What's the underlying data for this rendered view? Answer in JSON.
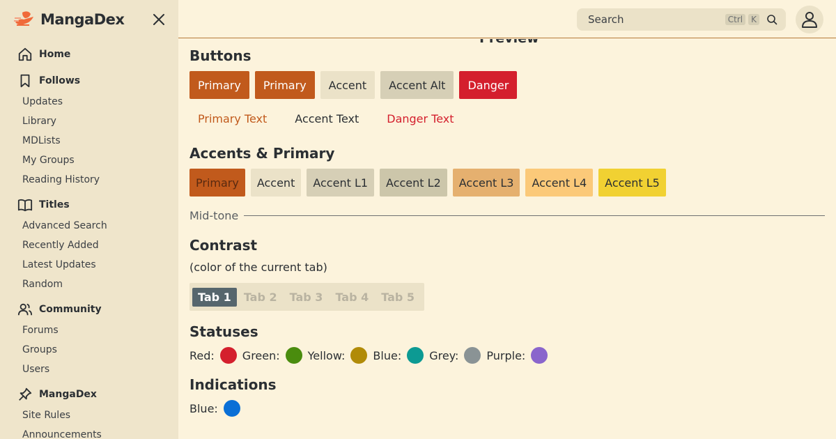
{
  "app": {
    "name": "MangaDex"
  },
  "sidebar": {
    "sections": [
      {
        "label": "Home",
        "icon": "home-icon",
        "items": []
      },
      {
        "label": "Follows",
        "icon": "bookmark-icon",
        "items": [
          "Updates",
          "Library",
          "MDLists",
          "My Groups",
          "Reading History"
        ]
      },
      {
        "label": "Titles",
        "icon": "book-open-icon",
        "items": [
          "Advanced Search",
          "Recently Added",
          "Latest Updates",
          "Random"
        ]
      },
      {
        "label": "Community",
        "icon": "users-icon",
        "items": [
          "Forums",
          "Groups",
          "Users"
        ]
      },
      {
        "label": "MangaDex",
        "icon": "pin-icon",
        "items": [
          "Site Rules",
          "Announcements"
        ]
      }
    ]
  },
  "header": {
    "search_placeholder": "Search",
    "kbd_ctrl": "Ctrl",
    "kbd_k": "K"
  },
  "main": {
    "clipped_title": "Preview",
    "buttons_heading": "Buttons",
    "buttons": [
      {
        "label": "Primary",
        "bg": "#c15a1c",
        "fg": "#ffffff"
      },
      {
        "label": "Primary",
        "bg": "#c15a1c",
        "fg": "#ffffff"
      },
      {
        "label": "Accent",
        "bg": "#ebe2c8",
        "fg": "#2b2f33"
      },
      {
        "label": "Accent Alt",
        "bg": "#d6cfb6",
        "fg": "#2b2f33"
      },
      {
        "label": "Danger",
        "bg": "#d41f2d",
        "fg": "#ffffff"
      }
    ],
    "text_buttons": [
      {
        "label": "Primary Text",
        "fg": "#c15a1c"
      },
      {
        "label": "Accent Text",
        "fg": "#2b2f33"
      },
      {
        "label": "Danger Text",
        "fg": "#d41f2d"
      }
    ],
    "accents_heading": "Accents & Primary",
    "swatches": [
      {
        "label": "Primary",
        "bg": "#c15a1c"
      },
      {
        "label": "Accent",
        "bg": "#ebe2c8"
      },
      {
        "label": "Accent L1",
        "bg": "#d6cfb6"
      },
      {
        "label": "Accent L2",
        "bg": "#ccc6aa"
      },
      {
        "label": "Accent L3",
        "bg": "#e5b06f"
      },
      {
        "label": "Accent L4",
        "bg": "#fbc979"
      },
      {
        "label": "Accent L5",
        "bg": "#f1d132"
      }
    ],
    "midtone_label": "Mid-tone",
    "contrast_heading": "Contrast",
    "contrast_sub": "(color of the current tab)",
    "tabs": [
      "Tab 1",
      "Tab 2",
      "Tab 3",
      "Tab 4",
      "Tab 5"
    ],
    "statuses_heading": "Statuses",
    "statuses": [
      {
        "label": "Red:",
        "color": "#d41f2d"
      },
      {
        "label": "Green:",
        "color": "#4a8c0e"
      },
      {
        "label": "Yellow:",
        "color": "#b18b08"
      },
      {
        "label": "Blue:",
        "color": "#0c9a93"
      },
      {
        "label": "Grey:",
        "color": "#8a9395"
      },
      {
        "label": "Purple:",
        "color": "#8a65cc"
      }
    ],
    "indications_heading": "Indications",
    "indications": [
      {
        "label": "Blue:",
        "color": "#0a6fd6"
      }
    ]
  }
}
